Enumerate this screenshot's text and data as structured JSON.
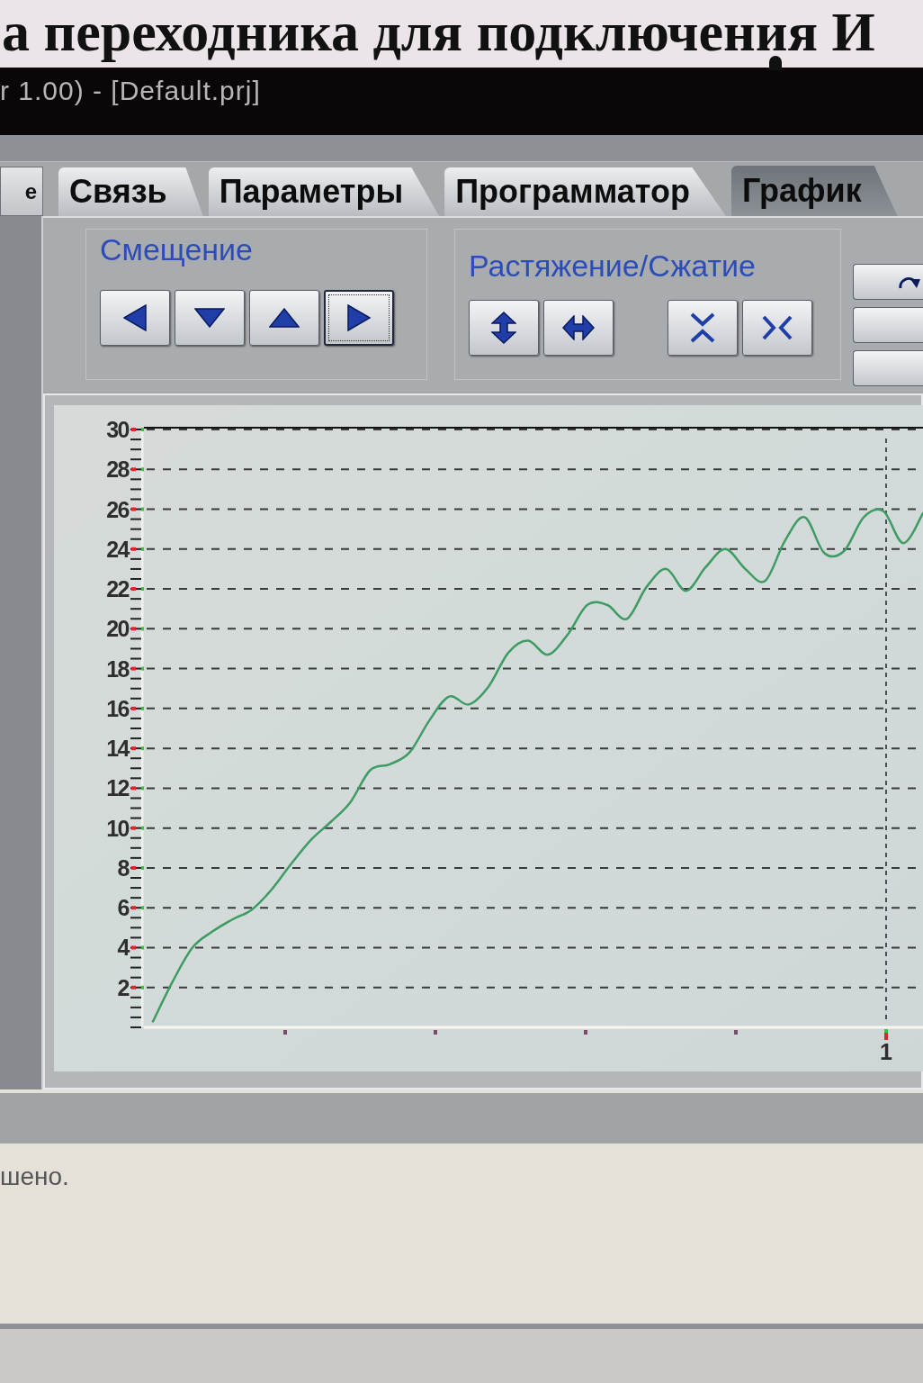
{
  "document_heading": {
    "text": "а переходника для подключения И"
  },
  "window": {
    "title": "r 1.00) - [Default.prj]"
  },
  "left_panel": {
    "tab_label": "е"
  },
  "tabs": [
    {
      "label": "Связь",
      "selected": false
    },
    {
      "label": "Параметры",
      "selected": false
    },
    {
      "label": "Программатор",
      "selected": false
    },
    {
      "label": "График",
      "selected": true
    }
  ],
  "toolbar": {
    "groups": [
      {
        "title": "Смещение",
        "button_sets": [
          [
            {
              "kind": "left",
              "focused": false
            },
            {
              "kind": "down",
              "focused": false
            },
            {
              "kind": "up",
              "focused": false
            },
            {
              "kind": "right",
              "focused": true
            }
          ]
        ]
      },
      {
        "title": "Растяжение/Сжатие",
        "button_sets": [
          [
            {
              "kind": "stretch_vertical",
              "focused": false
            },
            {
              "kind": "stretch_horizontal",
              "focused": false
            }
          ],
          [
            {
              "kind": "compress_vertical",
              "focused": false
            },
            {
              "kind": "compress_horizontal",
              "focused": false
            }
          ]
        ]
      }
    ],
    "side_buttons": [
      {
        "kind": "redo"
      },
      {
        "kind": "plain"
      },
      {
        "kind": "plain"
      }
    ]
  },
  "chart": {
    "chart_data": {
      "type": "line",
      "series": [
        {
          "color": "#3d9b63",
          "values": [
            0.3,
            2.3,
            4.0,
            4.8,
            5.4,
            5.9,
            6.9,
            8.2,
            9.4,
            10.3,
            11.3,
            12.9,
            13.2,
            13.8,
            15.4,
            16.6,
            16.2,
            17.1,
            18.8,
            19.4,
            18.7,
            19.7,
            21.2,
            21.2,
            20.5,
            22.1,
            23.0,
            21.9,
            23.1,
            24.0,
            23.0,
            22.4,
            24.4,
            25.6,
            23.8,
            23.9,
            25.6,
            25.9,
            24.3,
            25.8
          ]
        }
      ],
      "ylim": [
        0,
        30
      ],
      "yticks": [
        2,
        4,
        6,
        8,
        10,
        12,
        14,
        16,
        18,
        20,
        22,
        24,
        26,
        28,
        30
      ],
      "grid": true,
      "annotations": [
        "1"
      ]
    }
  },
  "status": {
    "text": "шено."
  }
}
